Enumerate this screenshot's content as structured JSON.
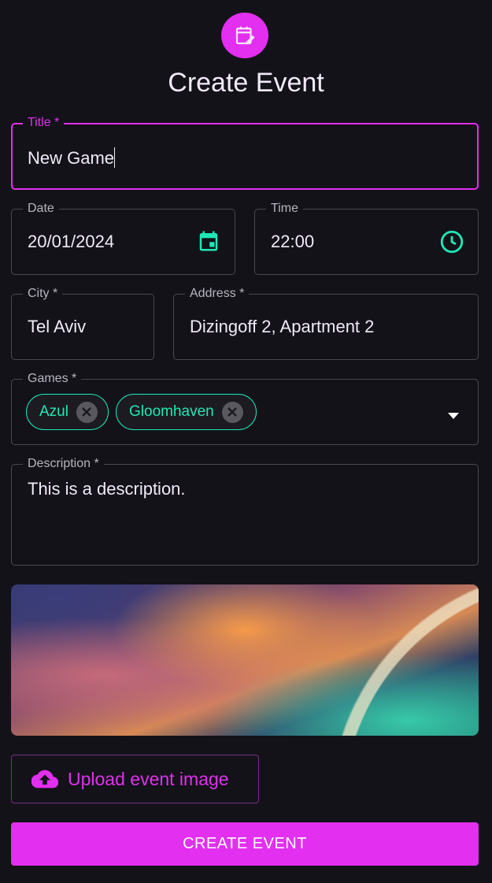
{
  "header": {
    "title": "Create Event",
    "icon": "calendar-edit-icon"
  },
  "fields": {
    "title": {
      "label": "Title *",
      "value": "New Game"
    },
    "date": {
      "label": "Date",
      "value": "20/01/2024"
    },
    "time": {
      "label": "Time",
      "value": "22:00"
    },
    "city": {
      "label": "City *",
      "value": "Tel Aviv"
    },
    "address": {
      "label": "Address *",
      "value": "Dizingoff 2, Apartment 2"
    },
    "games": {
      "label": "Games *",
      "chips": [
        "Azul",
        "Gloomhaven"
      ]
    },
    "description": {
      "label": "Description *",
      "value": "This is a description."
    }
  },
  "upload": {
    "label": "Upload event image"
  },
  "submit": {
    "label": "CREATE EVENT"
  },
  "colors": {
    "background": "#131219",
    "accent": "#e22ff0",
    "teal": "#1de9b6"
  }
}
